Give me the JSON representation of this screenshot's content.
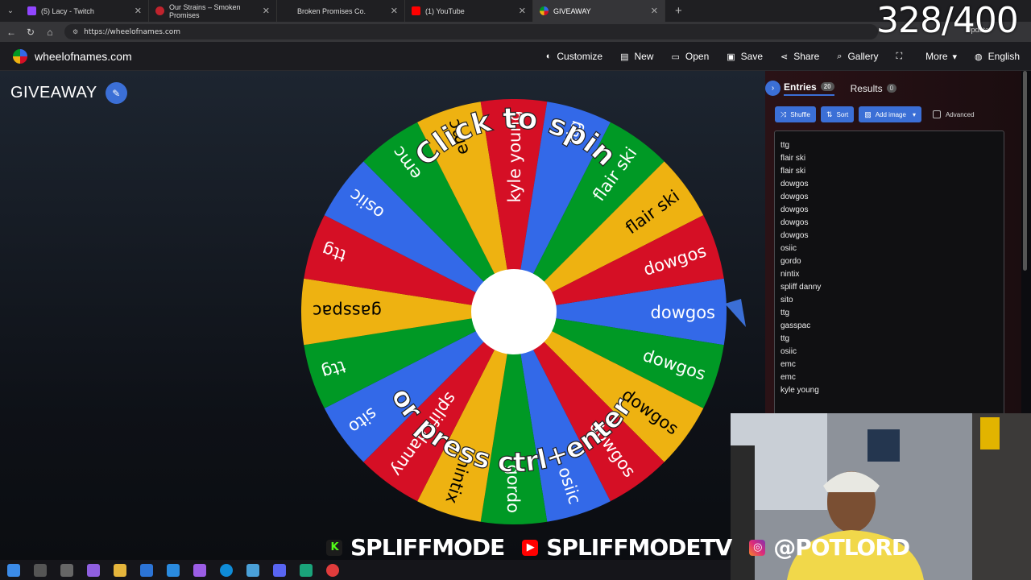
{
  "browser": {
    "tabs": [
      {
        "label": "(5) Lacy - Twitch",
        "color": "#9146ff",
        "active": false
      },
      {
        "label": "Our Strains – Smoken Promises",
        "color": "#c0232d",
        "active": false
      },
      {
        "label": "Broken Promises Co.",
        "color": "#333333",
        "active": false
      },
      {
        "label": "(1) YouTube",
        "color": "#ff0000",
        "active": false
      },
      {
        "label": "GIVEAWAY",
        "color": "#3369e8",
        "active": true
      }
    ],
    "url": "https://wheelofnames.com",
    "update_label": "Update"
  },
  "app": {
    "site_name": "wheelofnames.com",
    "toolbar": [
      {
        "label": "Customize",
        "icon": "palette-icon",
        "glyph": "◐"
      },
      {
        "label": "New",
        "icon": "new-file-icon",
        "glyph": "▤"
      },
      {
        "label": "Open",
        "icon": "folder-icon",
        "glyph": "▭"
      },
      {
        "label": "Save",
        "icon": "save-icon",
        "glyph": "▣"
      },
      {
        "label": "Share",
        "icon": "share-icon",
        "glyph": "⋖"
      },
      {
        "label": "Gallery",
        "icon": "search-icon",
        "glyph": "⌕"
      },
      {
        "label": "",
        "icon": "fullscreen-icon",
        "glyph": "⛶"
      },
      {
        "label": "More",
        "icon": "chevron-down-icon",
        "glyph": "▾"
      },
      {
        "label": "English",
        "icon": "globe-icon",
        "glyph": "◍"
      }
    ]
  },
  "wheel": {
    "title": "GIVEAWAY",
    "spin_text_top": "Click to spin",
    "spin_text_bottom": "or press ctrl+enter",
    "colors": {
      "red": "#d50f25",
      "blue": "#3369e8",
      "green": "#009925",
      "yellow": "#eeb211"
    },
    "slices": [
      "dowgos",
      "dowgos",
      "dowgos",
      "dowgos",
      "osiic",
      "gordo",
      "nintix",
      "spliff danny",
      "sito",
      "ttg",
      "gasspac",
      "ttg",
      "osiic",
      "emc",
      "emc",
      "kyle young",
      "ttg",
      "flair ski",
      "flair ski",
      "dowgos"
    ]
  },
  "panel": {
    "entries_tab": "Entries",
    "entries_count": "20",
    "results_tab": "Results",
    "results_count": "0",
    "shuffle_label": "Shuffle",
    "sort_label": "Sort",
    "add_image_label": "Add image",
    "advanced_label": "Advanced",
    "entries": [
      "ttg",
      "flair ski",
      "flair ski",
      "dowgos",
      "dowgos",
      "dowgos",
      "dowgos",
      "dowgos",
      "osiic",
      "gordo",
      "nintix",
      "spliff danny",
      "sito",
      "ttg",
      "gasspac",
      "ttg",
      "osiic",
      "emc",
      "emc",
      "kyle young"
    ]
  },
  "overlay": {
    "counter": "328/400",
    "social": [
      "SPLIFFMODE",
      "SPLIFFMODETV",
      "@POTLORD"
    ]
  }
}
